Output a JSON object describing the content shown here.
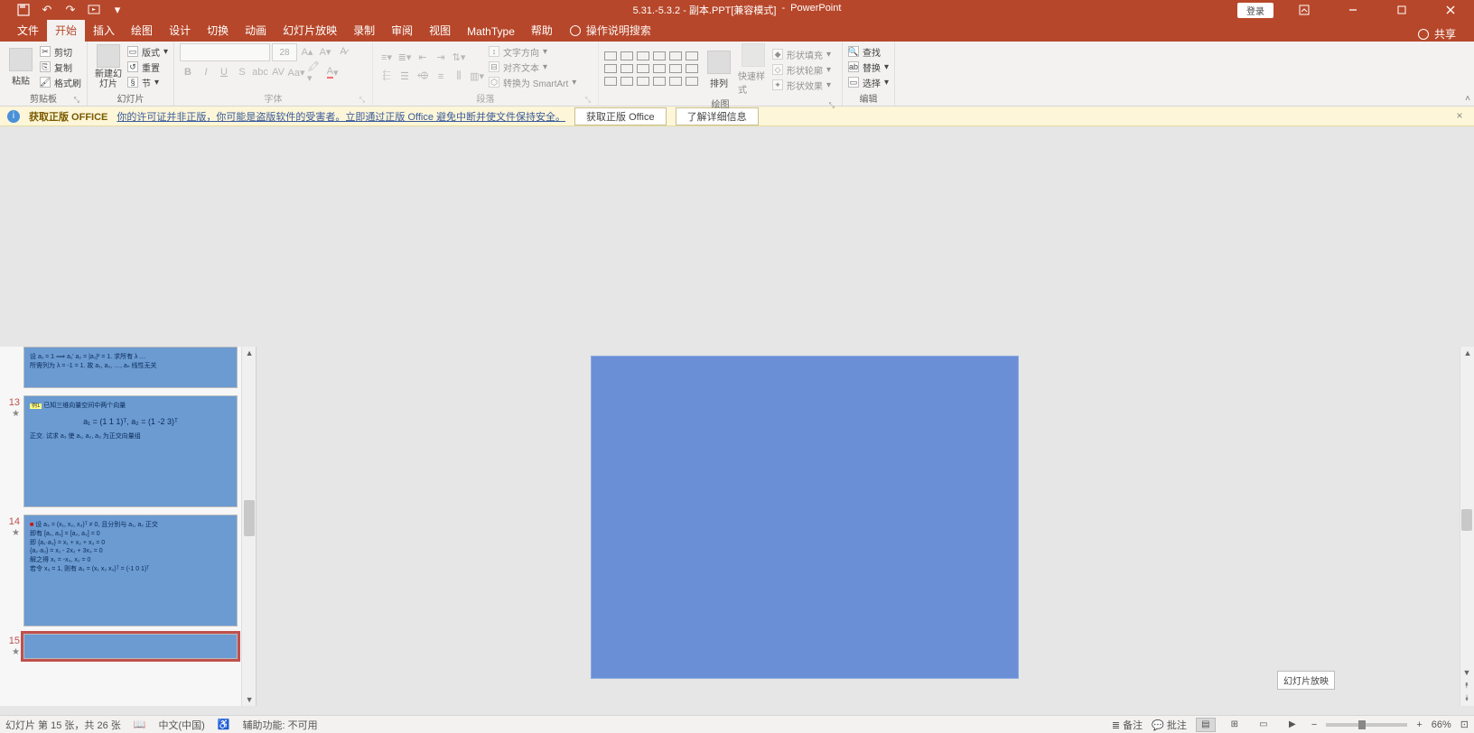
{
  "title": {
    "filename": "5.31.-5.3.2 - 副本.PPT[兼容模式]",
    "app": "PowerPoint",
    "login": "登录"
  },
  "qat": {
    "save": "💾",
    "undo": "↶",
    "redo": "↷",
    "start": "▢",
    "more": "▾"
  },
  "tabs": {
    "file": "文件",
    "home": "开始",
    "insert": "插入",
    "draw": "绘图",
    "design": "设计",
    "transitions": "切换",
    "animations": "动画",
    "slideshow": "幻灯片放映",
    "record": "录制",
    "review": "审阅",
    "view": "视图",
    "mathtype": "MathType",
    "help": "帮助",
    "tell_me": "操作说明搜索",
    "share": "共享"
  },
  "ribbon": {
    "clipboard": {
      "label": "剪贴板",
      "paste": "粘贴",
      "cut": "剪切",
      "copy": "复制",
      "format_painter": "格式刷"
    },
    "slides": {
      "label": "幻灯片",
      "new_slide": "新建幻灯片",
      "layout": "版式",
      "reset": "重置",
      "section": "节"
    },
    "font": {
      "label": "字体",
      "size_placeholder": "28"
    },
    "paragraph": {
      "label": "段落",
      "text_direction": "文字方向",
      "align_text": "对齐文本",
      "smartart": "转换为 SmartArt"
    },
    "drawing": {
      "label": "绘图",
      "arrange": "排列",
      "quick_styles": "快速样式",
      "shape_fill": "形状填充",
      "shape_outline": "形状轮廓",
      "shape_effects": "形状效果"
    },
    "editing": {
      "label": "编辑",
      "find": "查找",
      "replace": "替换",
      "select": "选择"
    }
  },
  "infobar": {
    "title": "获取正版 OFFICE",
    "message": "你的许可证并非正版，你可能是盗版软件的受害者。立即通过正版 Office 避免中断并使文件保持安全。",
    "btn_get": "获取正版 Office",
    "btn_learn": "了解详细信息"
  },
  "thumbs": {
    "partial": {
      "line1": "设 a₁ = 1 ⟹ a₁' a₂ = |a₁|² = 1.  求所有 λ …",
      "line2": "所需列为 λ = -1  =  1. 故 a₁, a₂, …, aₙ 线性无关"
    },
    "s13": {
      "num": "13",
      "badge": "例1",
      "line1": "已知三维向量空间中两个向量",
      "line2": "a₁ = (1 1 1)ᵀ,  a₂ = (1 -2 3)ᵀ",
      "line3": "正交. 试求 a₃ 使 a₁, a₂, a₃ 为正交向量组"
    },
    "s14": {
      "num": "14",
      "line1": "设 a₃ = (x₁, x₂, x₃)ᵀ ≠ 0, 且分别与 a₁, a₂ 正交",
      "line2": "即有   [a₁, a₃] = [a₂, a₃] = 0",
      "line3": "即     {a₁·a₃} = x₁ + x₂ + x₃ = 0",
      "line4": "         {a₂·a₃} = x₁ - 2x₂ + 3x₃ = 0",
      "line5": "解之得    x₁ = -x₃,  x₂ = 0",
      "line6": "若令 x₃ = 1, 则有    a₃ = (x₁ x₂ x₃)ᵀ = (-1 0 1)ᵀ"
    },
    "s15": {
      "num": "15"
    }
  },
  "tooltip": "幻灯片放映",
  "status": {
    "slide_info": "幻灯片 第 15 张，共 26 张",
    "language": "中文(中国)",
    "accessibility": "辅助功能: 不可用",
    "notes": "备注",
    "comments": "批注",
    "zoom": "66%"
  }
}
